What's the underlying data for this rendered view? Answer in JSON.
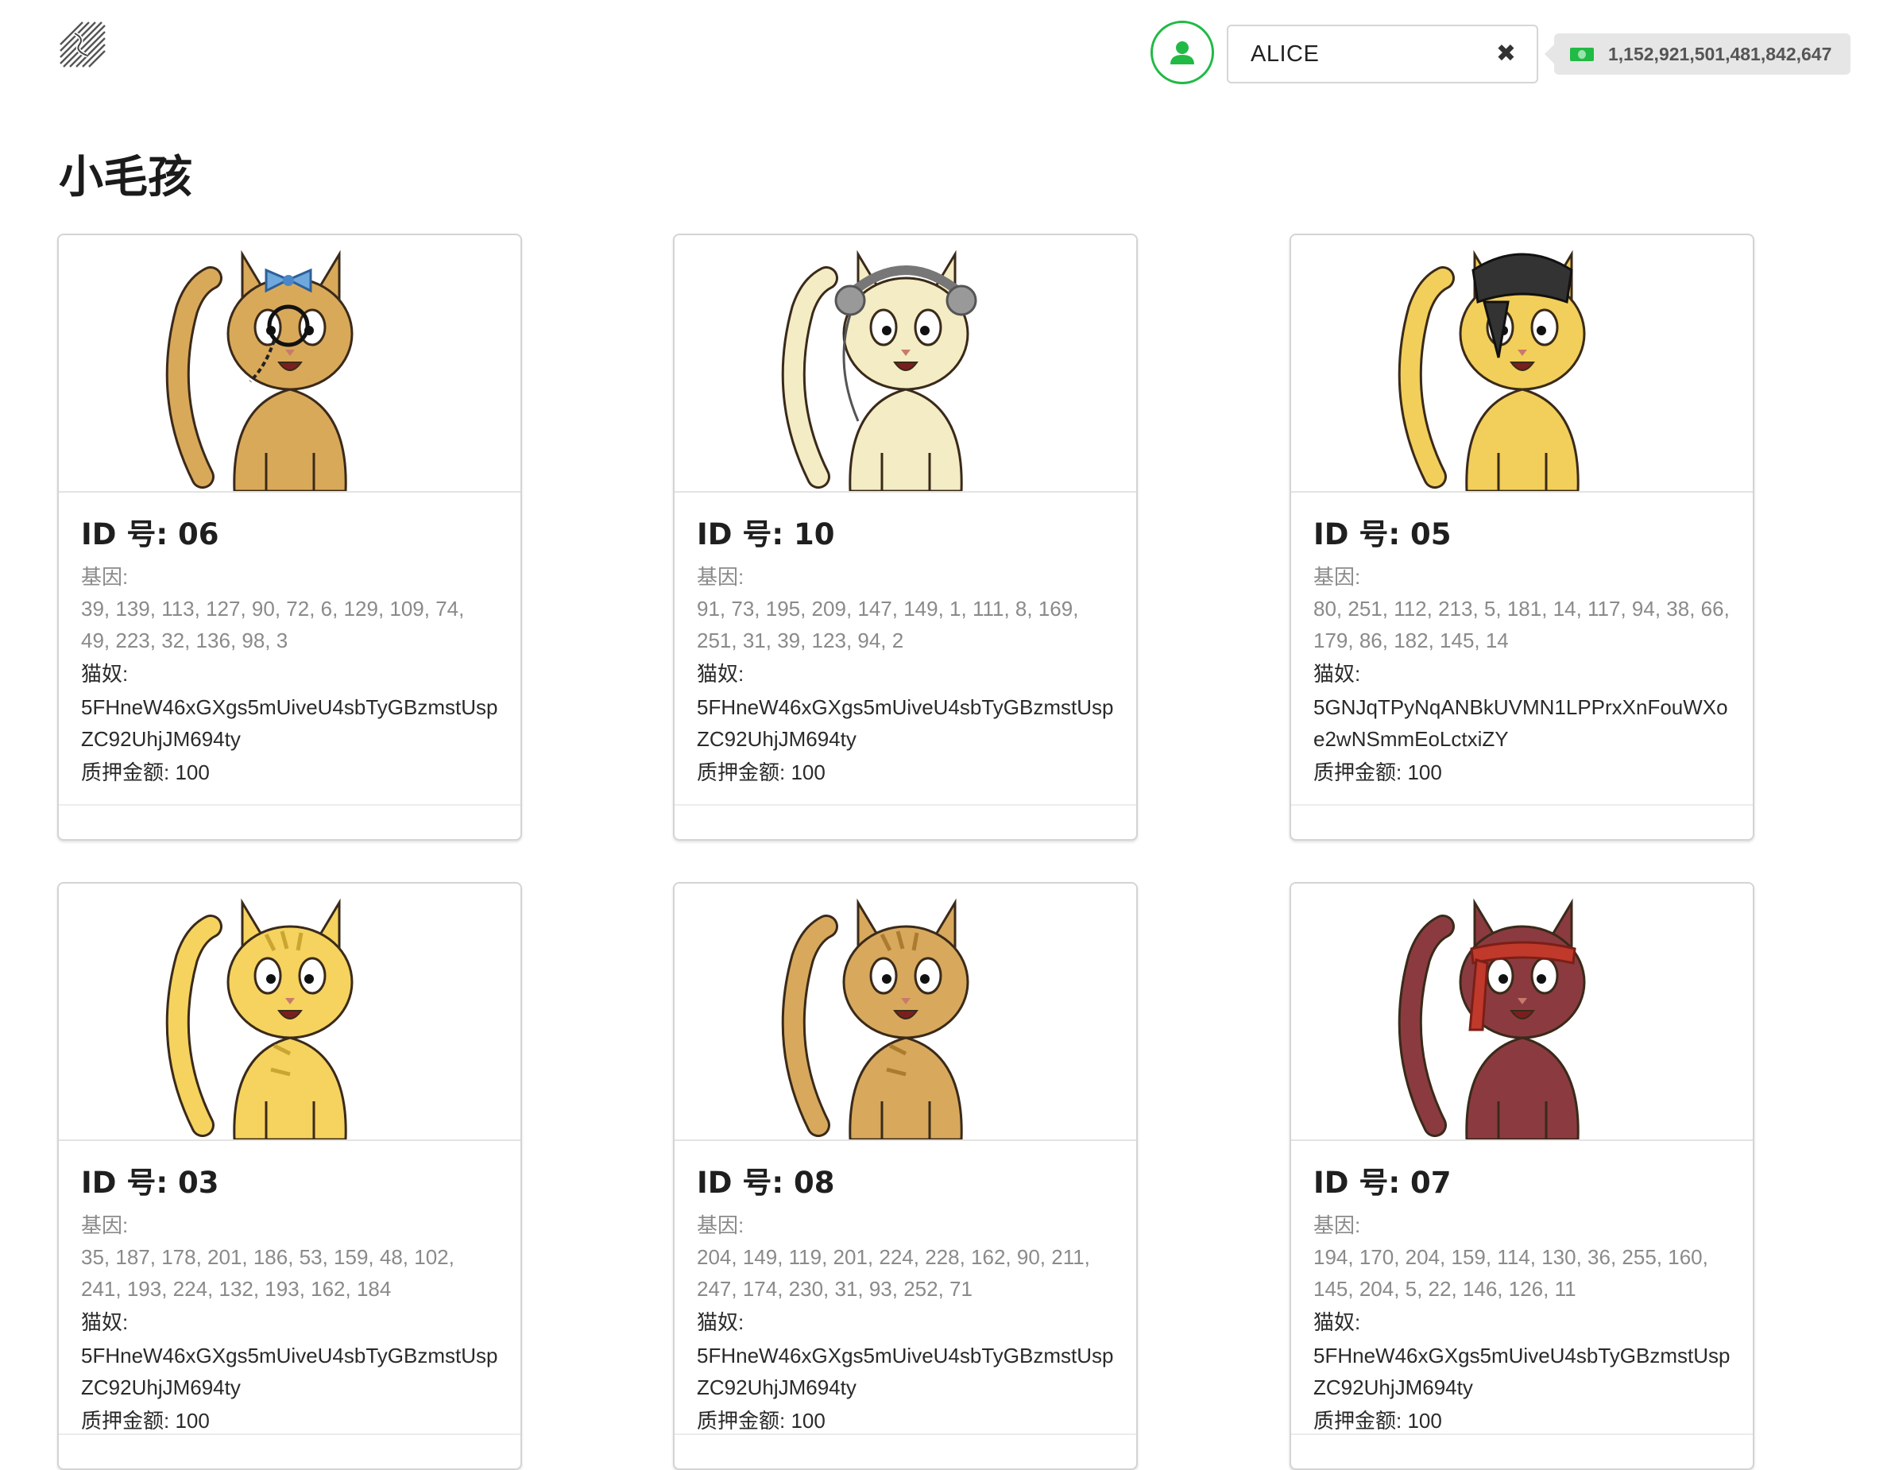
{
  "header": {
    "account_name": "ALICE",
    "balance": "1,152,921,501,481,842,647",
    "accent_color": "#21ba45"
  },
  "page_title": "小毛孩",
  "labels": {
    "id_prefix": "ID 号: ",
    "genes": "基因:",
    "owner": "猫奴:",
    "stake": "质押金额: "
  },
  "kitties": [
    {
      "id": "06",
      "genes": "39, 139, 113, 127, 90, 72, 6, 129, 109, 74, 49, 223, 32, 136, 98, 3",
      "owner": "5FHneW46xGXgs5mUiveU4sbTyGBzmstUspZC92UhjJM694ty",
      "stake": "100",
      "body_color": "#d9a95a",
      "accessory": "monocle-and-bow"
    },
    {
      "id": "10",
      "genes": "91, 73, 195, 209, 147, 149, 1, 111, 8, 169, 251, 31, 39, 123, 94, 2",
      "owner": "5FHneW46xGXgs5mUiveU4sbTyGBzmstUspZC92UhjJM694ty",
      "stake": "100",
      "body_color": "#f4ecc4",
      "accessory": "headphones"
    },
    {
      "id": "05",
      "genes": "80, 251, 112, 213, 5, 181, 14, 117, 94, 38, 66, 179, 86, 182, 145, 14",
      "owner": "5GNJqTPyNqANBkUVMN1LPPrxXnFouWXoe2wNSmmEoLctxiZY",
      "stake": "100",
      "body_color": "#f2cf5a",
      "accessory": "bandana"
    },
    {
      "id": "03",
      "genes": "35, 187, 178, 201, 186, 53, 159, 48, 102, 241, 193, 224, 132, 193, 162, 184",
      "owner": "5FHneW46xGXgs5mUiveU4sbTyGBzmstUspZC92UhjJM694ty",
      "stake": "100",
      "body_color": "#f5d35e",
      "accessory": "stripes"
    },
    {
      "id": "08",
      "genes": "204, 149, 119, 201, 224, 228, 162, 90, 211, 247, 174, 230, 31, 93, 252, 71",
      "owner": "5FHneW46xGXgs5mUiveU4sbTyGBzmstUspZC92UhjJM694ty",
      "stake": "100",
      "body_color": "#d8a95c",
      "accessory": "stripes"
    },
    {
      "id": "07",
      "genes": "194, 170, 204, 159, 114, 130, 36, 255, 160, 145, 204, 5, 22, 146, 126, 11",
      "owner": "5FHneW46xGXgs5mUiveU4sbTyGBzmstUspZC92UhjJM694ty",
      "stake": "100",
      "body_color": "#8b3b40",
      "accessory": "headband"
    }
  ]
}
